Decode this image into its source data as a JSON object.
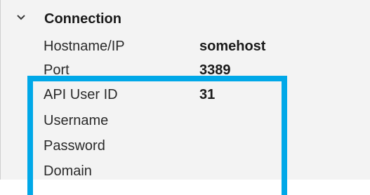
{
  "section": {
    "icon": "chevron-down-icon",
    "title": "Connection"
  },
  "properties": [
    {
      "label": "Hostname/IP",
      "value": "somehost"
    },
    {
      "label": "Port",
      "value": "3389"
    },
    {
      "label": "API User ID",
      "value": "31"
    },
    {
      "label": "Username",
      "value": ""
    },
    {
      "label": "Password",
      "value": ""
    },
    {
      "label": "Domain",
      "value": ""
    }
  ],
  "highlight": {
    "color": "#00a8e8"
  }
}
